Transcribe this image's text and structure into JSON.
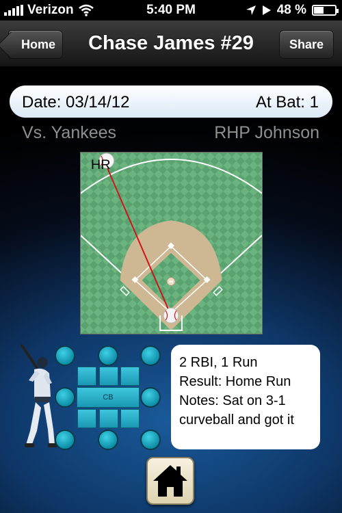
{
  "status_bar": {
    "carrier": "Verizon",
    "time": "5:40 PM",
    "battery_text": "48 %",
    "battery_level": 0.48
  },
  "nav": {
    "back_label": "Home",
    "title": "Chase James #29",
    "share_label": "Share"
  },
  "at_bat_info": {
    "date": "Date: 03/14/12",
    "at_bat": "At Bat: 1",
    "opponent": "Vs. Yankees",
    "pitcher": "RHP Johnson"
  },
  "field": {
    "hit_label": "HR"
  },
  "strike_zone": {
    "center_label": "CB"
  },
  "result": {
    "line1": "2 RBI, 1 Run",
    "line2": "Result: Home Run",
    "line3": "Notes: Sat on 3-1 curveball and got it"
  },
  "icons": {
    "nav_home": "home-icon",
    "location": "location-arrow-icon",
    "play": "play-icon",
    "wifi": "wifi-icon"
  },
  "colors": {
    "field_green": "#5fa874",
    "infield_dirt": "#cdb893",
    "hit_line": "#d0141a",
    "zone_cyan": "#1ca7c2"
  }
}
